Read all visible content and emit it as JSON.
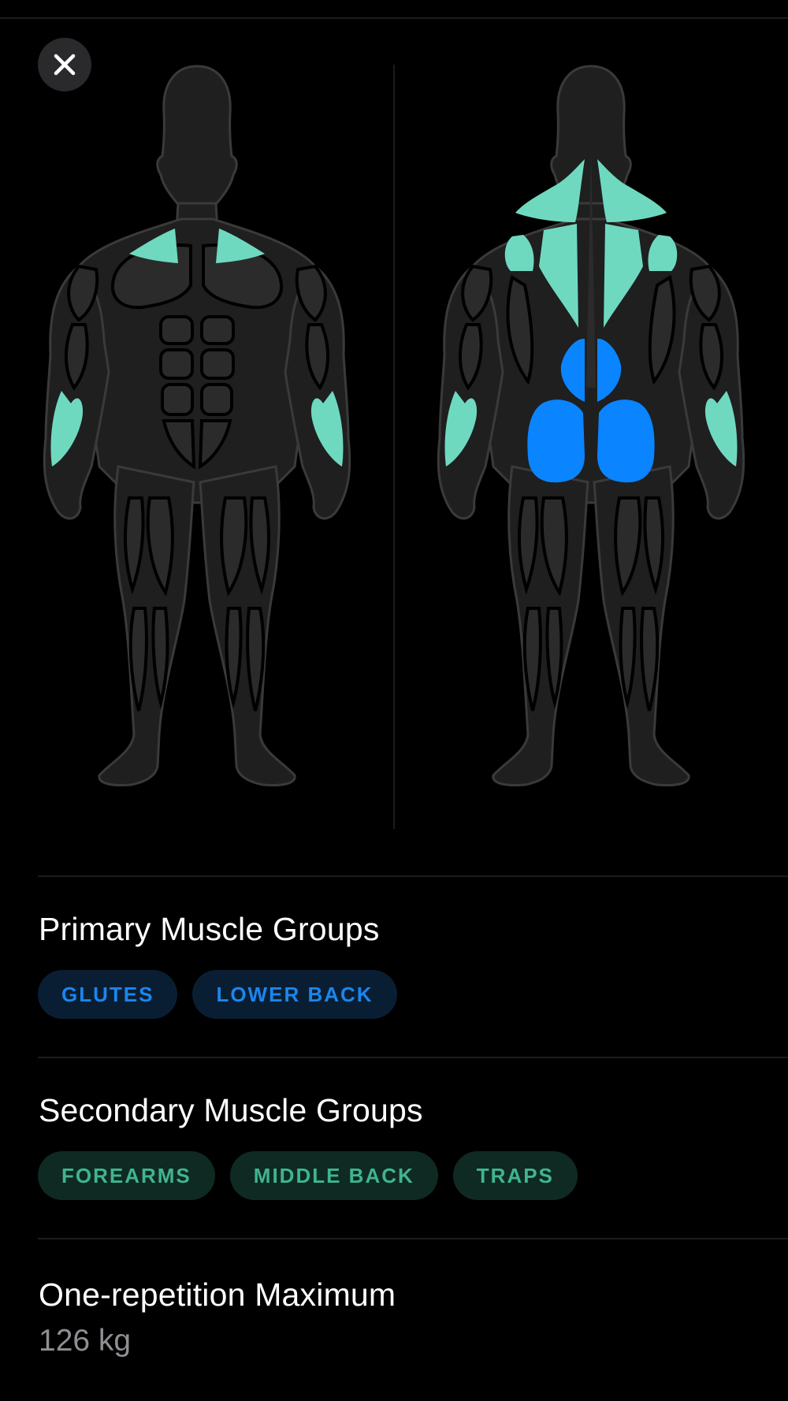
{
  "close_button": {
    "icon": "close-icon"
  },
  "colors": {
    "primary_muscle": "#0a84ff",
    "secondary_muscle": "#6fd9c0",
    "body_fill": "#1f1f1f",
    "body_outline": "#3a3a3a",
    "primary_chip_bg": "#0a1e33",
    "primary_chip_text": "#1b86ee",
    "secondary_chip_bg": "#0f2a22",
    "secondary_chip_text": "#3fb58f"
  },
  "muscle_map": {
    "front_view": {
      "highlighted_secondary": [
        "traps",
        "forearms"
      ]
    },
    "back_view": {
      "highlighted_primary": [
        "glutes",
        "lower back"
      ],
      "highlighted_secondary": [
        "traps",
        "middle back",
        "forearms"
      ]
    }
  },
  "primary_section": {
    "title": "Primary Muscle Groups",
    "chips": [
      "GLUTES",
      "LOWER BACK"
    ]
  },
  "secondary_section": {
    "title": "Secondary Muscle Groups",
    "chips": [
      "FOREARMS",
      "MIDDLE BACK",
      "TRAPS"
    ]
  },
  "one_rep_max": {
    "title": "One-repetition Maximum",
    "value": "126 kg"
  }
}
